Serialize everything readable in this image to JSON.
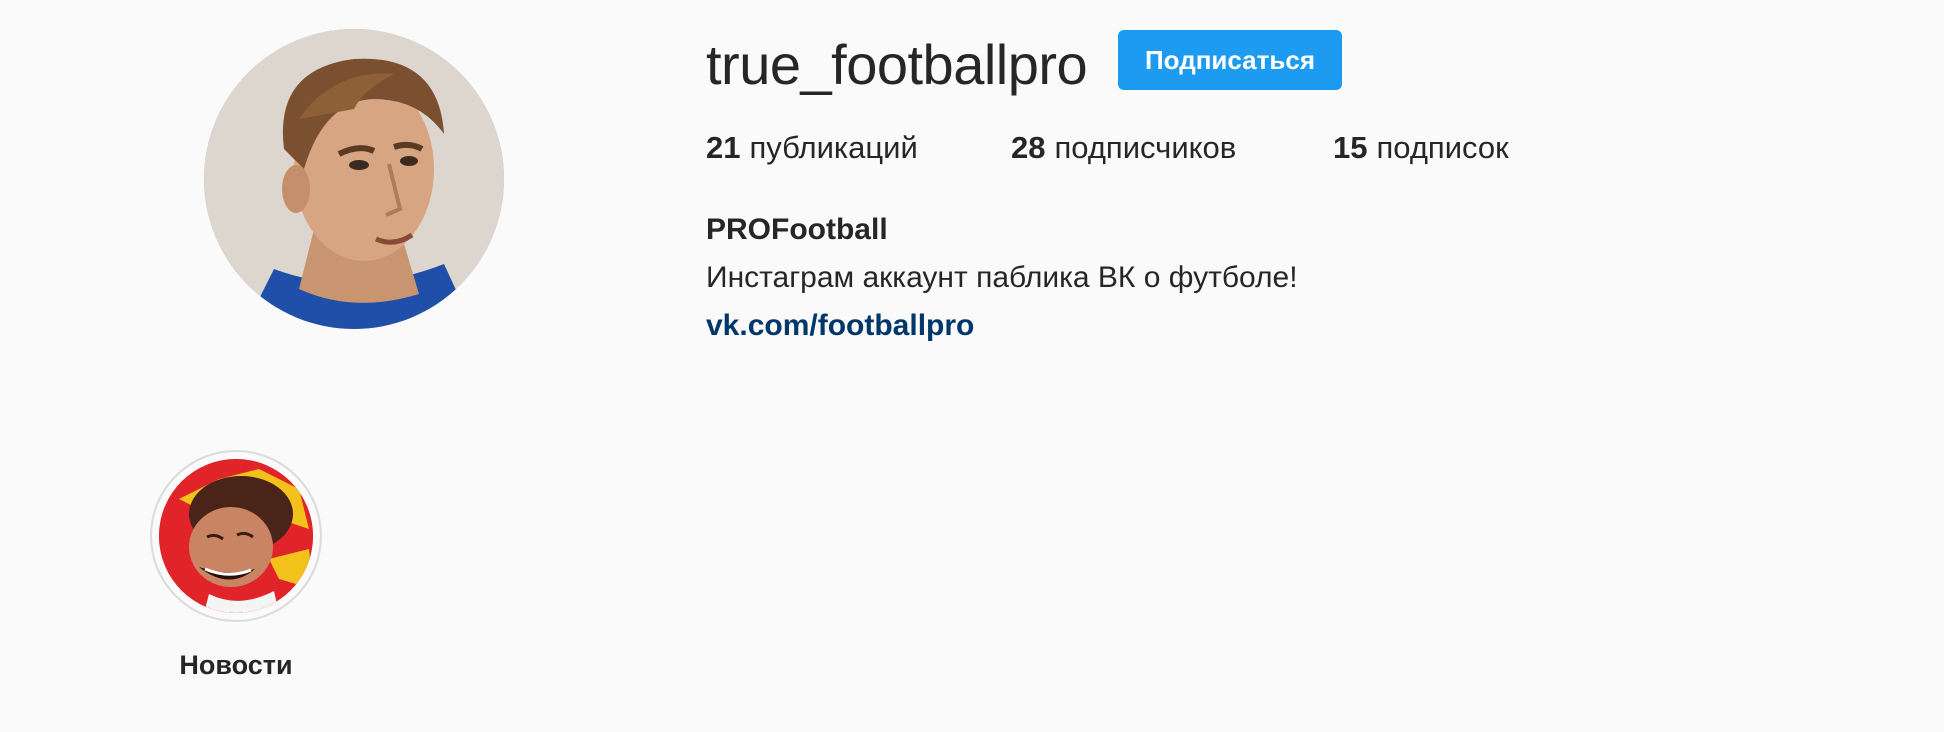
{
  "profile": {
    "username": "true_footballpro",
    "follow_label": "Подписаться",
    "avatar_icon": "profile-photo",
    "accent_color": "#1d9bf0",
    "link_color": "#00376b"
  },
  "stats": {
    "posts_count": "21",
    "posts_label": "публикаций",
    "followers_count": "28",
    "followers_label": "подписчиков",
    "following_count": "15",
    "following_label": "подписок"
  },
  "bio": {
    "name": "PROFootball",
    "text": "Инстаграм аккаунт паблика ВК о футболе!",
    "link": "vk.com/footballpro"
  },
  "highlights": [
    {
      "label": "Новости",
      "icon": "highlight-cover"
    }
  ]
}
